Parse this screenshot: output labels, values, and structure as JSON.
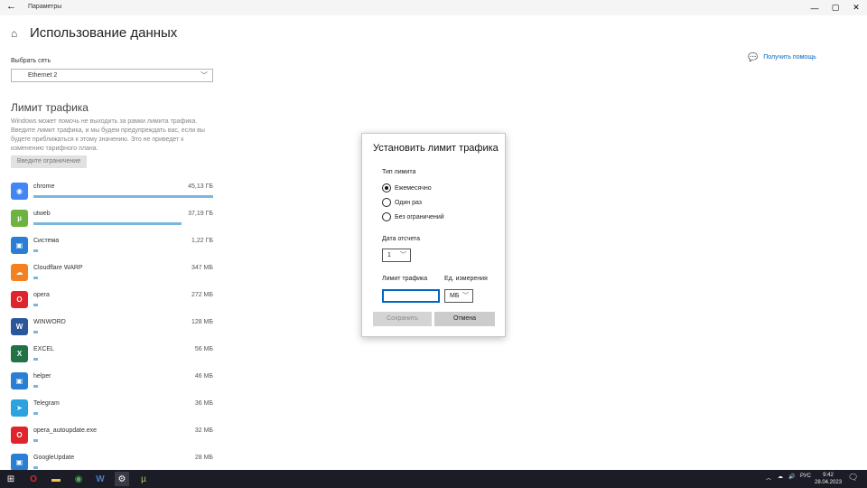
{
  "window": {
    "title": "Параметры"
  },
  "page": {
    "title": "Использование данных",
    "help_link": "Получить помощь"
  },
  "network": {
    "label": "Выбрать сеть",
    "selected": "Ethernet 2"
  },
  "traffic_limit": {
    "title": "Лимит трафика",
    "description": "Windows может помочь не выходить за рамки лимита трафика. Введите лимит трафика, и мы будем предупреждать вас, если вы будете приближаться к этому значению. Это не приведет к изменению тарифного плана.",
    "button_label": "Введите ограничение"
  },
  "apps": [
    {
      "name": "chrome",
      "size": "45,13 ГБ",
      "usage": 1.0,
      "color": "#4285f4",
      "icon": "chrome-icon"
    },
    {
      "name": "utweb",
      "size": "37,19 ГБ",
      "usage": 0.824,
      "color": "#6cb33f",
      "icon": "utweb-icon"
    },
    {
      "name": "Система",
      "size": "1,22 ГБ",
      "usage": 0.027,
      "color": "#2a7fd4",
      "icon": "system-icon"
    },
    {
      "name": "Cloudflare WARP",
      "size": "347 МБ",
      "usage": 0.008,
      "color": "#f48120",
      "icon": "cloudflare-icon"
    },
    {
      "name": "opera",
      "size": "272 МБ",
      "usage": 0.006,
      "color": "#e0242b",
      "icon": "opera-icon"
    },
    {
      "name": "WINWORD",
      "size": "128 МБ",
      "usage": 0.003,
      "color": "#2b579a",
      "icon": "word-icon"
    },
    {
      "name": "EXCEL",
      "size": "56 МБ",
      "usage": 0.002,
      "color": "#217346",
      "icon": "excel-icon"
    },
    {
      "name": "helper",
      "size": "46 МБ",
      "usage": 0.001,
      "color": "#2a7fd4",
      "icon": "helper-icon"
    },
    {
      "name": "Telegram",
      "size": "36 МБ",
      "usage": 0.001,
      "color": "#2aa3df",
      "icon": "telegram-icon"
    },
    {
      "name": "opera_autoupdate.exe",
      "size": "32 МБ",
      "usage": 0.001,
      "color": "#e0242b",
      "icon": "opera-update-icon"
    },
    {
      "name": "GoogleUpdate",
      "size": "28 МБ",
      "usage": 0.001,
      "color": "#2a7fd4",
      "icon": "google-update-icon"
    }
  ],
  "dialog": {
    "title": "Установить лимит трафика",
    "limit_type_label": "Тип лимита",
    "options": [
      "Ежемесячно",
      "Один раз",
      "Без ограничений"
    ],
    "selected_option": 0,
    "reset_date_label": "Дата отсчета",
    "reset_date_value": "1",
    "limit_label": "Лимит трафика",
    "limit_value": "",
    "unit_label": "Ед. измерения",
    "unit_value": "МБ",
    "save_label": "Сохранить",
    "cancel_label": "Отмена"
  },
  "taskbar": {
    "pinned": [
      "windows-start-icon",
      "opera-icon",
      "file-explorer-icon",
      "chrome-icon",
      "word-icon",
      "settings-icon",
      "utweb-icon"
    ],
    "language": "РУС",
    "time": "9:42",
    "date": "28.04.2023"
  }
}
